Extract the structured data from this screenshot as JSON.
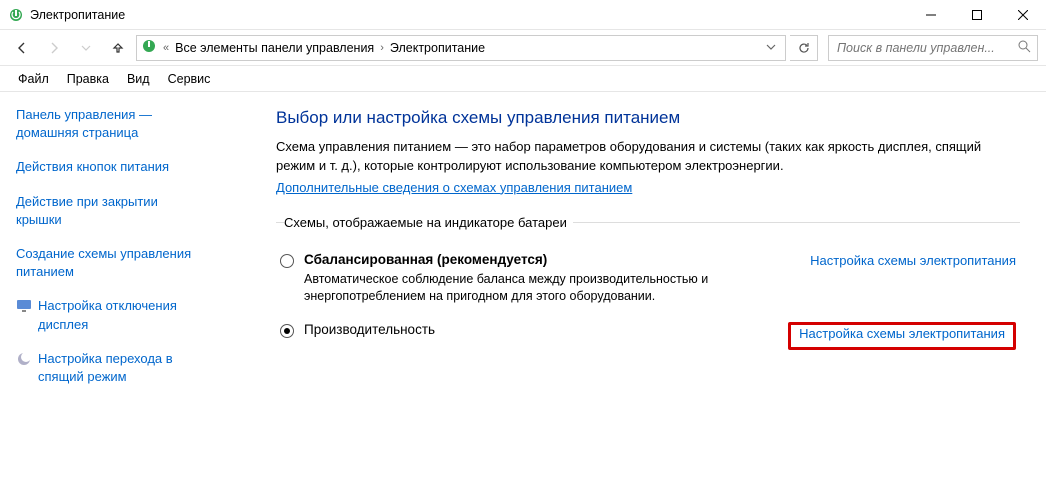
{
  "titlebar": {
    "title": "Электропитание"
  },
  "breadcrumb": {
    "root_glyph": "«",
    "seg1": "Все элементы панели управления",
    "seg2": "Электропитание"
  },
  "search": {
    "placeholder": "Поиск в панели управлен..."
  },
  "menu": {
    "file": "Файл",
    "edit": "Правка",
    "view": "Вид",
    "service": "Сервис"
  },
  "sidebar": {
    "home1": "Панель управления —",
    "home2": "домашняя страница",
    "l1": "Действия кнопок питания",
    "l2a": "Действие при закрытии",
    "l2b": "крышки",
    "l3a": "Создание схемы управления",
    "l3b": "питанием",
    "l4a": "Настройка отключения",
    "l4b": "дисплея",
    "l5a": "Настройка перехода в",
    "l5b": "спящий режим"
  },
  "main": {
    "h1": "Выбор или настройка схемы управления питанием",
    "desc": "Схема управления питанием — это набор параметров оборудования и системы (таких как яркость дисплея, спящий режим и т. д.), которые контролируют использование компьютером электроэнергии.",
    "more_link": "Дополнительные сведения о схемах управления питанием",
    "legend": "Схемы, отображаемые на индикаторе батареи",
    "plan1": {
      "name": "Сбалансированная (рекомендуется)",
      "desc": "Автоматическое соблюдение баланса между производительностью и энергопотреблением на пригодном для этого оборудовании.",
      "config": "Настройка схемы электропитания"
    },
    "plan2": {
      "name": "Производительность",
      "config": "Настройка схемы электропитания"
    }
  }
}
